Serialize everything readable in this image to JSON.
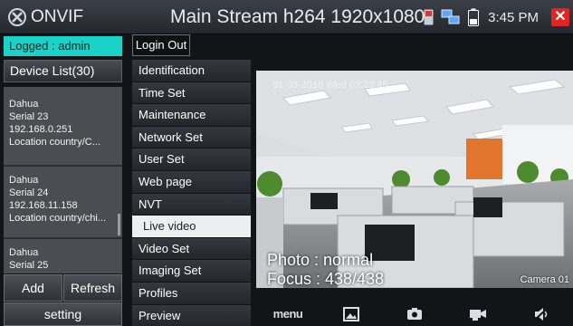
{
  "titlebar": {
    "app_name": "ONVIF",
    "stream": "Main Stream h264 1920x1080",
    "time": "3:45 PM",
    "close_glyph": "✕",
    "icons": [
      "onvif-logo-icon",
      "sd-card-icon",
      "network-icon",
      "battery-icon",
      "close-icon"
    ]
  },
  "left": {
    "logged": "Logged : admin",
    "device_list": "Device List(30)",
    "devices": [
      {
        "name": "Dahua",
        "serial": "Serial 23",
        "ip": "192.168.0.251",
        "location": "Location country/C..."
      },
      {
        "name": "Dahua",
        "serial": "Serial 24",
        "ip": "192.168.11.158",
        "location": "Location country/chi..."
      },
      {
        "name": "Dahua",
        "serial": "Serial 25",
        "ip": "",
        "location": ""
      }
    ],
    "add": "Add",
    "refresh": "Refresh",
    "setting": "setting"
  },
  "login_out": "Login Out",
  "menu": {
    "items": [
      "Identification",
      "Time Set",
      "Maintenance",
      "Network Set",
      "User Set",
      "Web page",
      "NVT",
      "Live video",
      "Video Set",
      "Imaging Set",
      "Profiles",
      "Preview"
    ],
    "active": "Live video"
  },
  "video": {
    "timestamp": "01-03-2018 Wed 03:23:45",
    "photo": "Photo : normal",
    "focus": "Focus : 438/438",
    "camera": "Camera 01"
  },
  "toolbar": {
    "menu_label": "menu",
    "icons": [
      "image-icon",
      "camera-icon",
      "video-record-icon",
      "speaker-mute-icon"
    ]
  },
  "colors": {
    "logged_bg": "#19d3c8",
    "close_bg": "#e2261f",
    "active_menu_bg": "#eceef0"
  }
}
